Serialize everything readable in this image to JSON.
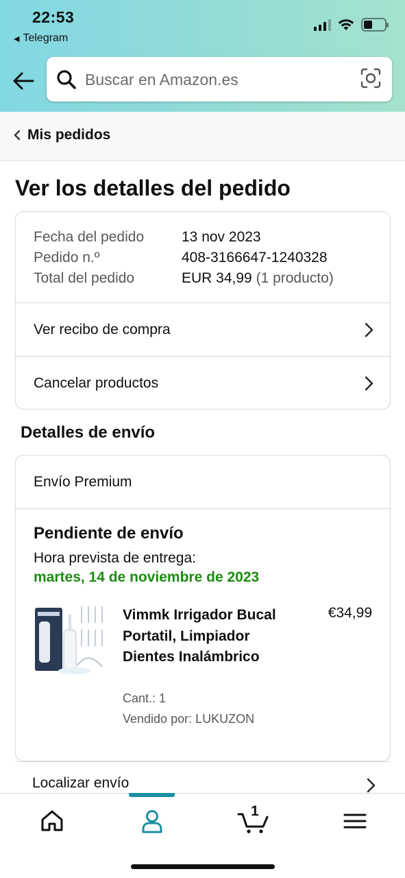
{
  "status_bar": {
    "time": "22:53",
    "back_app": "Telegram"
  },
  "search": {
    "placeholder": "Buscar en Amazon.es"
  },
  "breadcrumb": {
    "label": "Mis pedidos"
  },
  "page": {
    "title": "Ver los detalles del pedido"
  },
  "order_summary": {
    "rows": [
      {
        "key": "Fecha del pedido",
        "value": "13 nov 2023"
      },
      {
        "key": "Pedido n.º",
        "value": "408-3166647-1240328"
      },
      {
        "key": "Total del pedido",
        "value": "EUR 34,99",
        "extra": "(1 producto)"
      }
    ],
    "links": [
      {
        "label": "Ver recibo de compra"
      },
      {
        "label": "Cancelar productos"
      }
    ]
  },
  "shipping": {
    "section_title": "Detalles de envío",
    "method": "Envío Premium",
    "status": "Pendiente de envío",
    "eta_label": "Hora prevista de entrega:",
    "eta_date": "martes, 14 de noviembre de 2023",
    "product": {
      "title": "Vimmk Irrigador Bucal Portatil, Limpiador Dientes Inalámbrico",
      "price": "€34,99",
      "quantity": "Cant.: 1",
      "seller": "Vendido por: LUKUZON"
    },
    "track_link": "Localizar envío"
  },
  "bottom_nav": {
    "active": "account",
    "cart_count": "1",
    "items": [
      "home-icon",
      "account-icon",
      "cart-icon",
      "menu-icon"
    ]
  },
  "colors": {
    "header_gradient_start": "#82d8e3",
    "header_gradient_end": "#a5e2ce",
    "delivery_green": "#1e8a12",
    "nav_active": "#1b8fa3"
  }
}
